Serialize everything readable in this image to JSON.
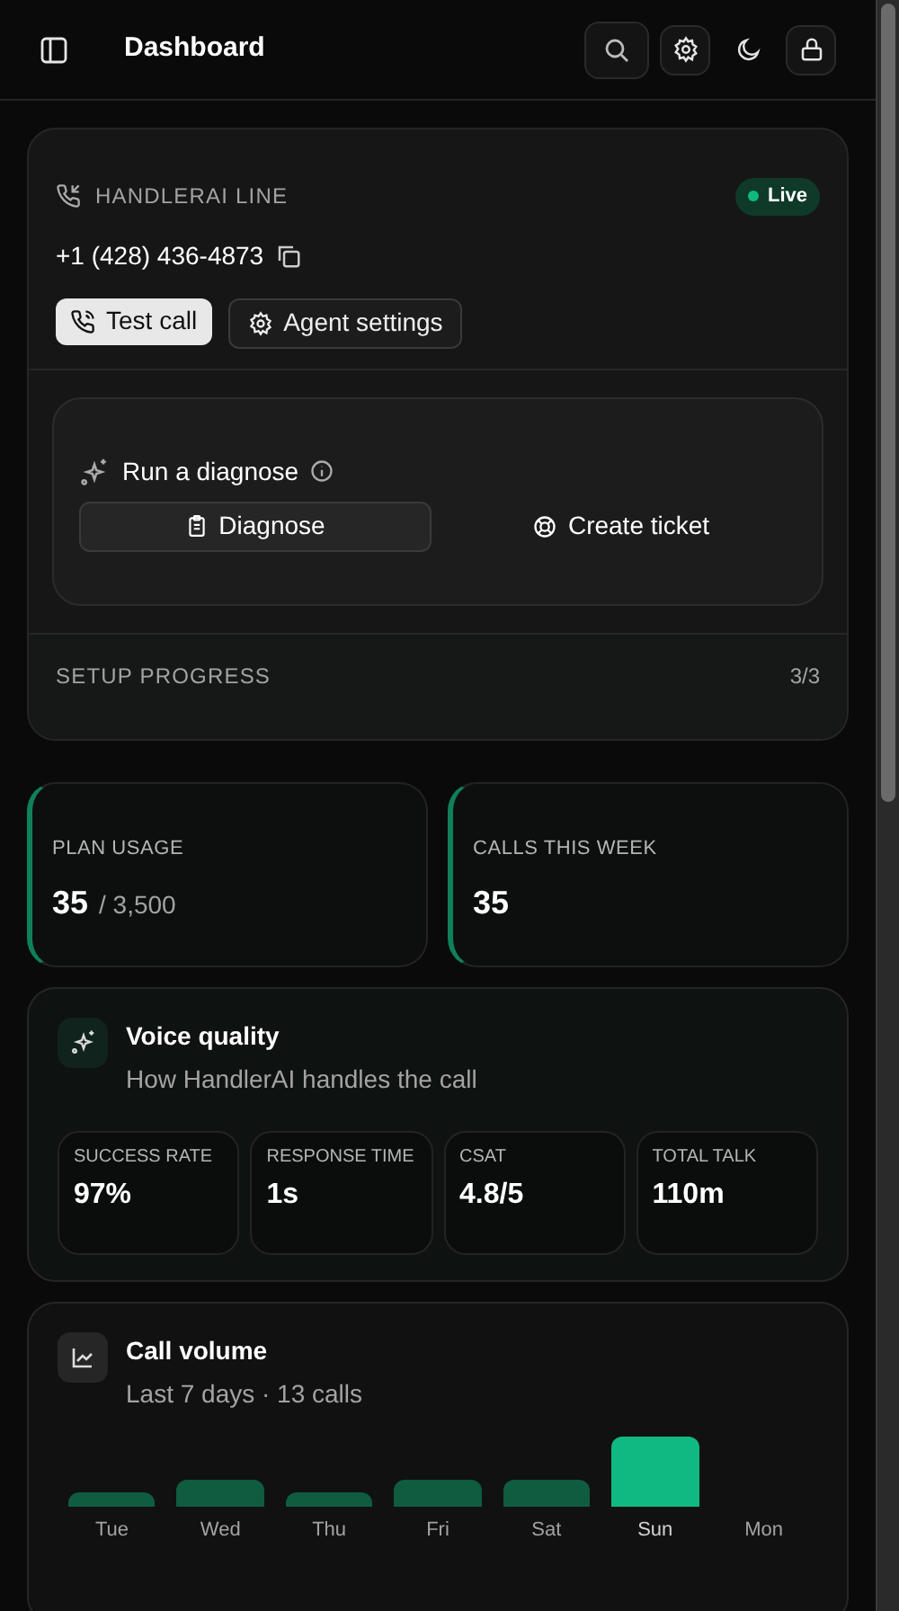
{
  "header": {
    "title": "Dashboard"
  },
  "line_card": {
    "label": "HANDLERAI LINE",
    "badge": "Live",
    "phone": "+1 (428) 436-4873",
    "buttons": [
      {
        "label": "Test call",
        "kind": "primary"
      },
      {
        "label": "Agent settings",
        "kind": "secondary"
      }
    ],
    "diagnose": {
      "title": "Run a diagnose",
      "actions": [
        {
          "label": "Diagnose",
          "kind": "outlined"
        },
        {
          "label": "Create ticket",
          "kind": "plain"
        }
      ]
    },
    "setup": {
      "label": "SETUP PROGRESS",
      "count": "3/3"
    }
  },
  "stats": [
    {
      "label": "PLAN USAGE",
      "value": "35",
      "total": "/ 3,500"
    },
    {
      "label": "CALLS THIS WEEK",
      "value": "35"
    }
  ],
  "voice_quality": {
    "title": "Voice quality",
    "subtitle": "How HandlerAI handles the call",
    "metrics": [
      {
        "label": "SUCCESS RATE",
        "value": "97%"
      },
      {
        "label": "RESPONSE TIME",
        "value": "1s"
      },
      {
        "label": "CSAT",
        "value": "4.8/5"
      },
      {
        "label": "TOTAL TALK",
        "value": "110m"
      }
    ]
  },
  "call_volume": {
    "title": "Call volume",
    "subtitle": "Last 7 days · 13 calls",
    "days": [
      {
        "label": "Tue",
        "highlighted": false
      },
      {
        "label": "Wed",
        "highlighted": false
      },
      {
        "label": "Thu",
        "highlighted": false
      },
      {
        "label": "Fri",
        "highlighted": false
      },
      {
        "label": "Sat",
        "highlighted": false
      },
      {
        "label": "Sun",
        "highlighted": true
      },
      {
        "label": "Mon",
        "highlighted": false
      }
    ]
  }
}
